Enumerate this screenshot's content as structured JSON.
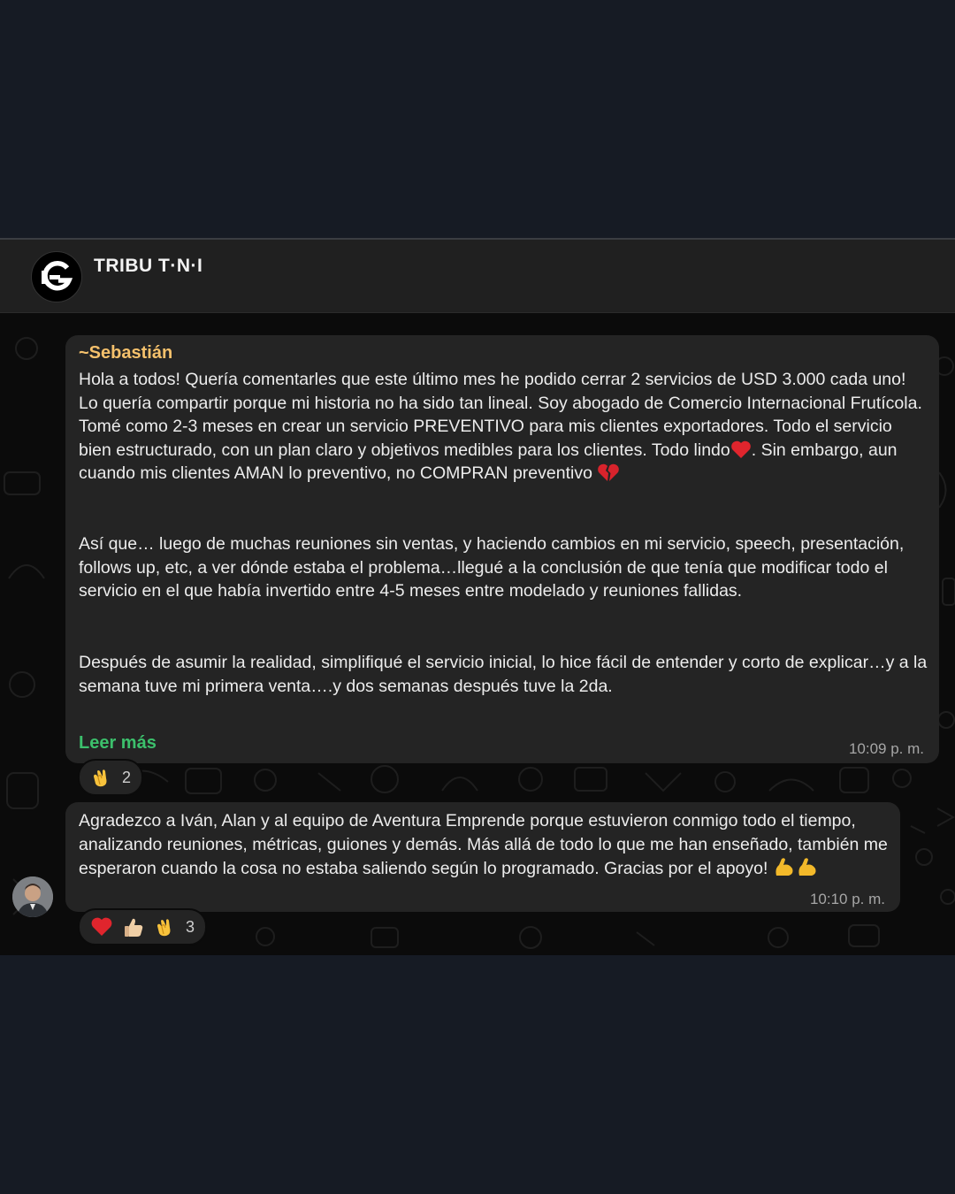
{
  "group": {
    "name": "TRIBU T·N·I"
  },
  "messages": [
    {
      "sender": "~Sebastián",
      "paragraphs": [
        "Hola a todos! Quería comentarles que este último mes he podido cerrar 2 servicios de USD 3.000 cada uno! Lo quería compartir porque mi historia no ha sido tan lineal. Soy abogado de Comercio Internacional Frutícola. Tomé como 2-3 meses en crear un servicio PREVENTIVO para mis clientes exportadores. Todo el servicio bien estructurado, con un plan claro y objetivos medibles para los clientes. Todo lindo",
        ". Sin embargo, aun cuando mis clientes AMAN lo preventivo, no COMPRAN preventivo",
        "Así que… luego de muchas reuniones sin ventas, y haciendo cambios en mi servicio, speech, presentación, follows up, etc, a ver dónde estaba el problema…llegué a la conclusión de que tenía que modificar todo el servicio en el que había invertido entre 4-5 meses entre modelado y reuniones fallidas.",
        "Después de asumir la realidad, simplifiqué el servicio inicial, lo hice fácil de entender y corto de explicar…y a la semana tuve mi primera venta….y dos semanas después tuve la 2da."
      ],
      "read_more": "Leer más",
      "time": "10:09 p. m.",
      "reactions": [
        {
          "emoji": "clapping-hands",
          "count": "2"
        }
      ]
    },
    {
      "text": "Agradezco a Iván, Alan y al equipo de Aventura Emprende porque estuvieron conmigo todo el tiempo, analizando reuniones, métricas, guiones y demás. Más allá de todo lo que me han enseñado, también me esperaron cuando la cosa no estaba saliendo según lo programado. Gracias por el apoyo!",
      "time": "10:10 p. m.",
      "reactions": [
        {
          "emoji": "red-heart"
        },
        {
          "emoji": "thumbs-up"
        },
        {
          "emoji": "clapping-hands",
          "count": "3"
        }
      ]
    }
  ],
  "colors": {
    "page_background": "#161b24",
    "header": "#202020",
    "bubble": "#242424",
    "sender_name": "#f5c16c",
    "read_more": "#3cc06c",
    "timestamp": "#a6a6a6"
  }
}
